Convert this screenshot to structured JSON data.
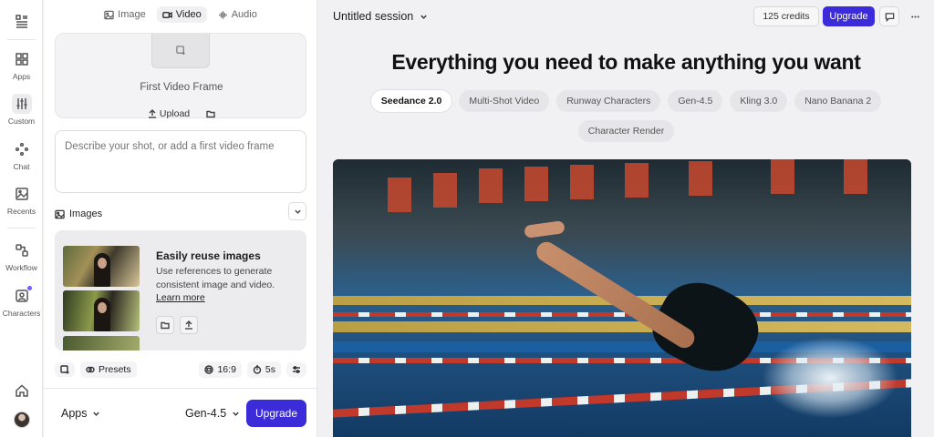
{
  "rail": {
    "items": [
      {
        "label": "Apps"
      },
      {
        "label": "Custom"
      },
      {
        "label": "Chat"
      },
      {
        "label": "Recents"
      },
      {
        "label": "Workflow"
      },
      {
        "label": "Characters"
      }
    ]
  },
  "panel": {
    "tabs": [
      {
        "label": "Image",
        "icon": "image-icon"
      },
      {
        "label": "Video",
        "icon": "video-icon",
        "active": true
      },
      {
        "label": "Audio",
        "icon": "audio-wave-icon"
      }
    ],
    "frame": {
      "title": "First Video Frame",
      "upload_label": "Upload"
    },
    "prompt_placeholder": "Describe your shot, or add a first video frame",
    "images_header": "Images",
    "reuse": {
      "title": "Easily reuse images",
      "description": "Use references to generate consistent image and video.",
      "link": "Learn more"
    },
    "options": {
      "presets_label": "Presets",
      "aspect_ratio": "16:9",
      "duration": "5s"
    },
    "bottom": {
      "apps_label": "Apps",
      "model_label": "Gen-4.5",
      "upgrade_label": "Upgrade"
    }
  },
  "header": {
    "session_title": "Untitled session",
    "credits": "125 credits",
    "upgrade_label": "Upgrade"
  },
  "main": {
    "headline": "Everything you need to make anything you want",
    "pills": [
      {
        "label": "Seedance 2.0",
        "active": true
      },
      {
        "label": "Multi-Shot Video"
      },
      {
        "label": "Runway Characters"
      },
      {
        "label": "Gen-4.5"
      },
      {
        "label": "Kling 3.0"
      },
      {
        "label": "Nano Banana 2"
      },
      {
        "label": "Character Render"
      }
    ]
  },
  "colors": {
    "accent": "#3b2bd9",
    "notification_dot": "#6e5cff"
  }
}
